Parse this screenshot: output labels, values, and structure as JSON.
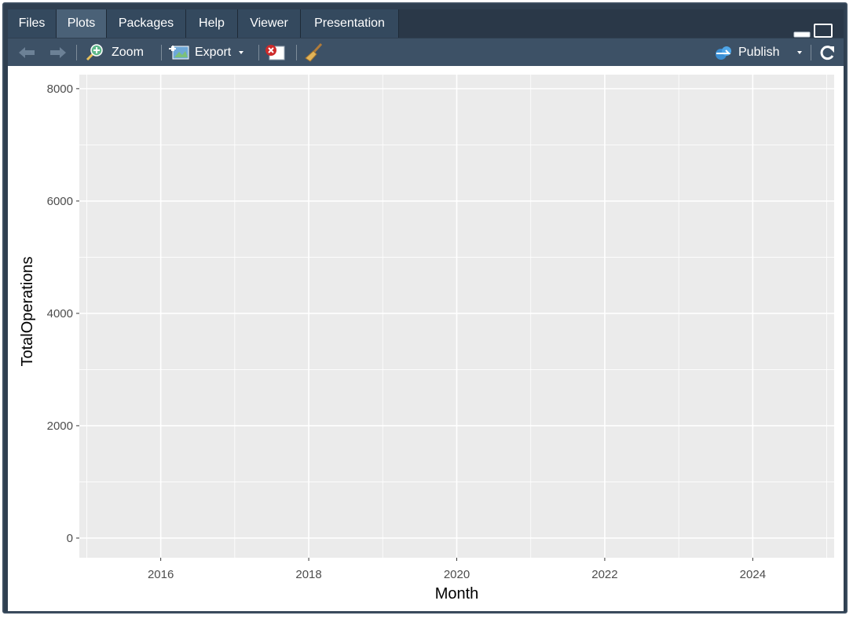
{
  "tabs": [
    {
      "label": "Files",
      "active": false
    },
    {
      "label": "Plots",
      "active": true
    },
    {
      "label": "Packages",
      "active": false
    },
    {
      "label": "Help",
      "active": false
    },
    {
      "label": "Viewer",
      "active": false
    },
    {
      "label": "Presentation",
      "active": false
    }
  ],
  "toolbar": {
    "zoom_label": "Zoom",
    "export_label": "Export",
    "publish_label": "Publish",
    "icons": [
      "back-arrow-icon",
      "forward-arrow-icon",
      "zoom-icon",
      "export-icon",
      "remove-plot-icon",
      "broom-icon",
      "publish-icon",
      "refresh-icon"
    ]
  },
  "colors": {
    "accent": "#4a6177",
    "panel_bg": "#ebebeb",
    "grid": "#ffffff"
  },
  "chart_data": {
    "type": "line",
    "title": "",
    "xlabel": "Month",
    "ylabel": "TotalOperations",
    "x_ticks": [
      "2016",
      "2018",
      "2020",
      "2022",
      "2024"
    ],
    "y_ticks": [
      "0",
      "2000",
      "4000",
      "6000",
      "8000"
    ],
    "xlim": [
      2014.9,
      2025.1
    ],
    "ylim": [
      -350,
      8250
    ],
    "grid": true,
    "series": []
  }
}
